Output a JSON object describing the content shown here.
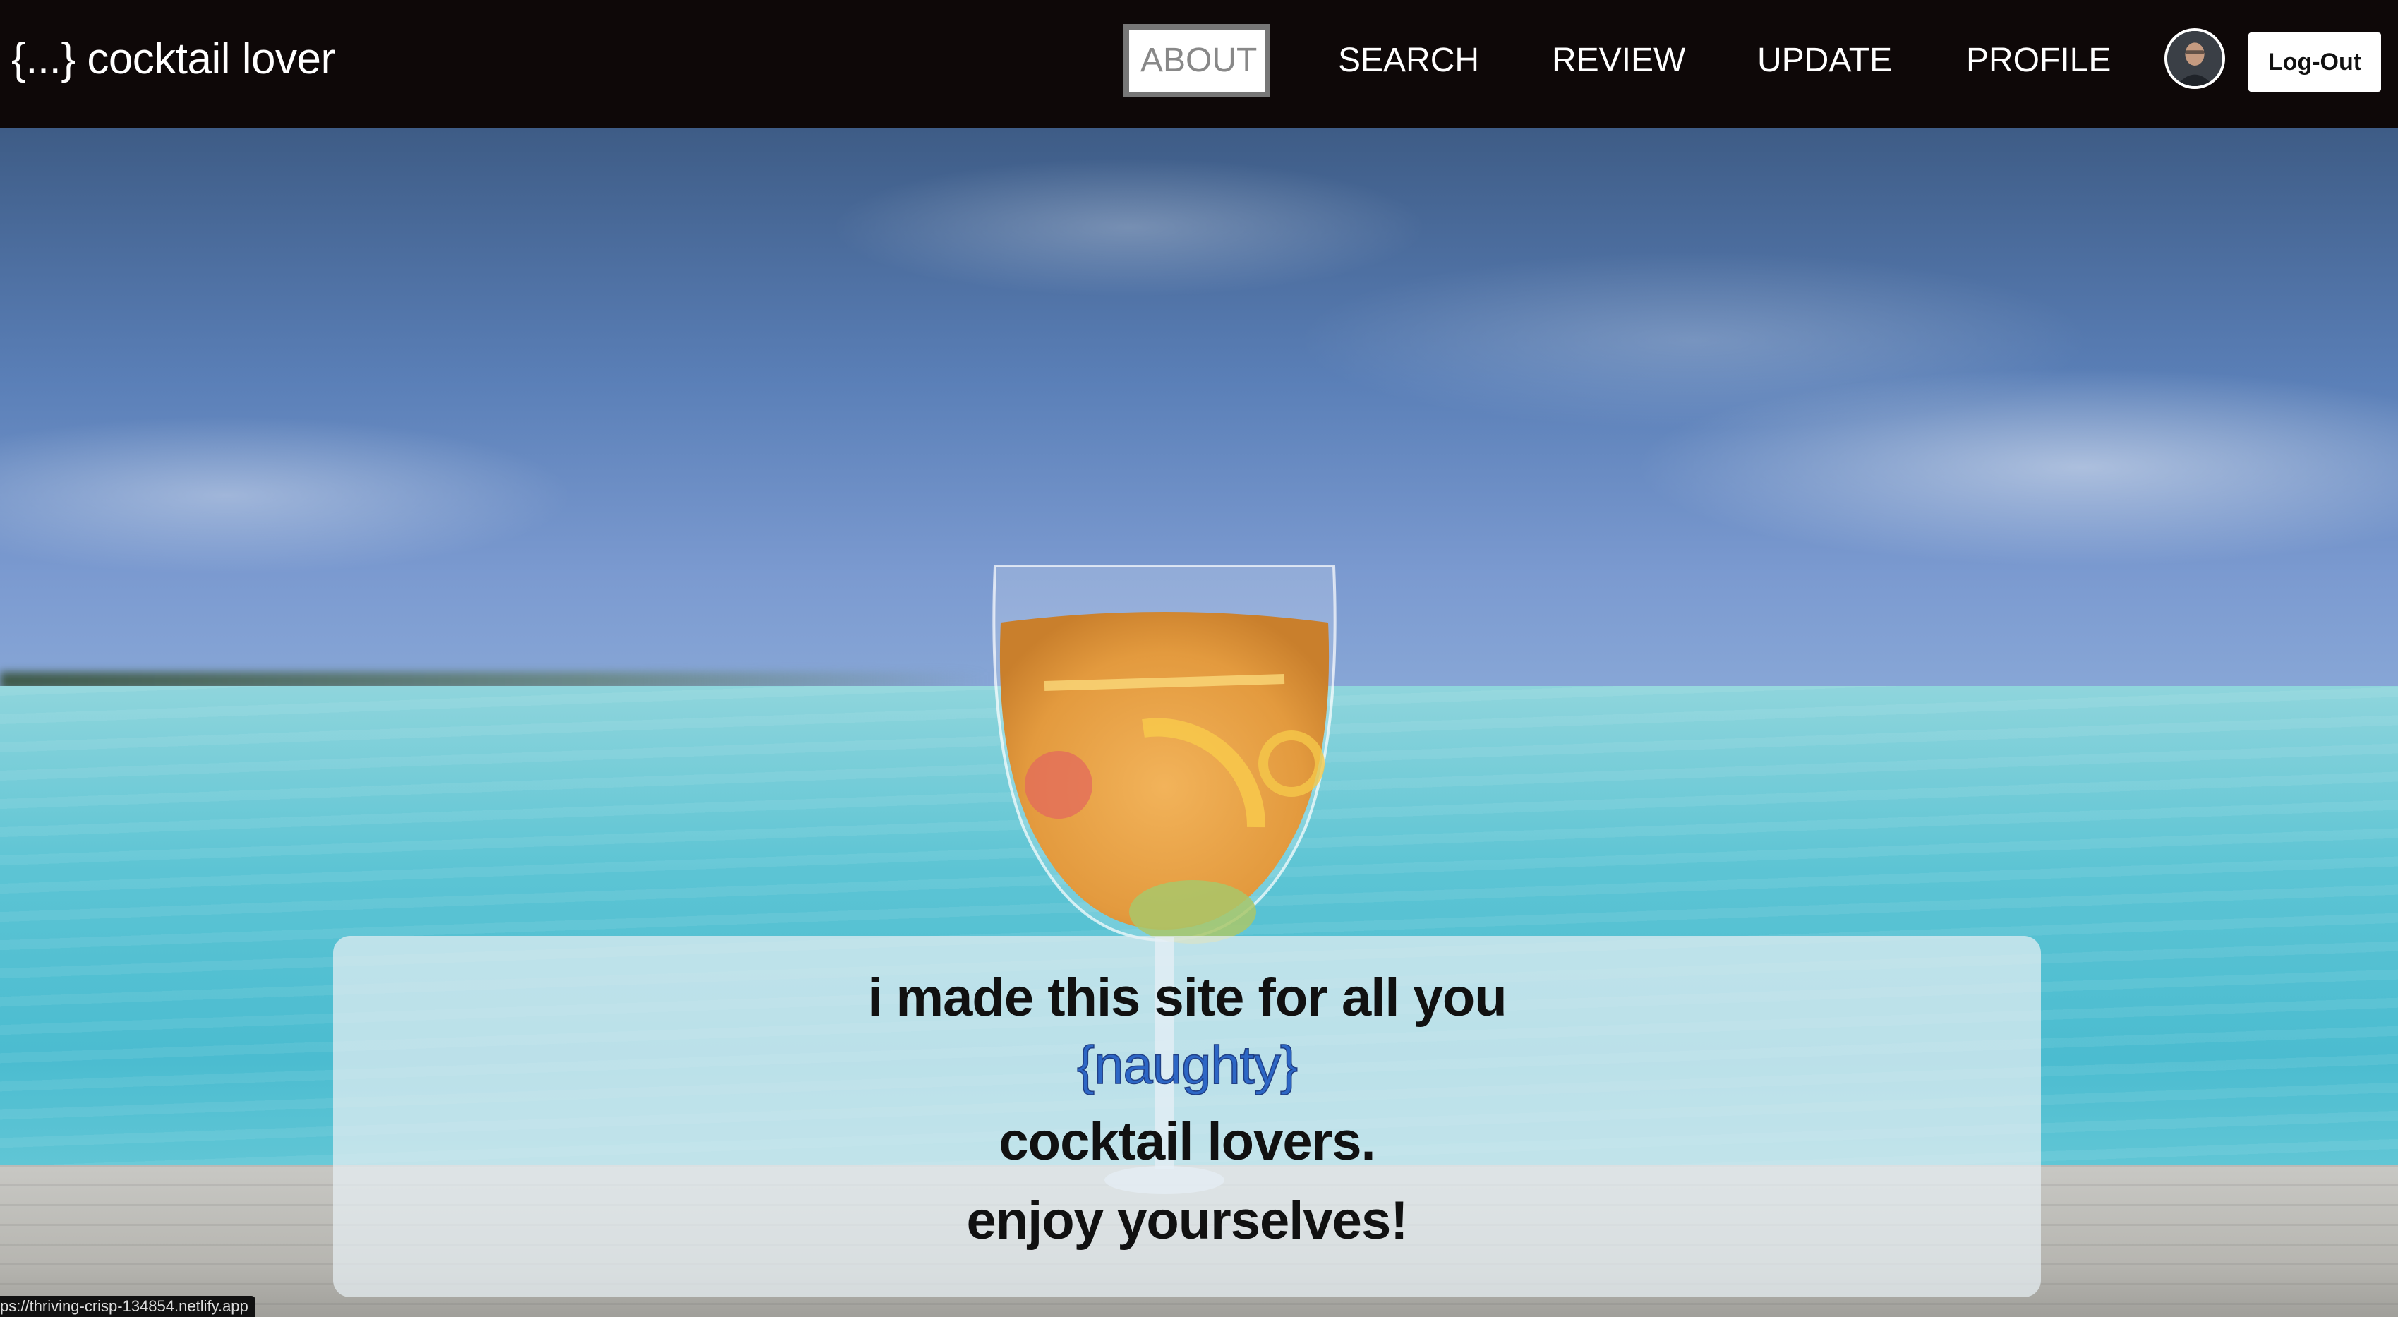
{
  "navbar": {
    "brand": "{...} cocktail lover",
    "items": [
      {
        "label": "ABOUT",
        "active": true
      },
      {
        "label": "SEARCH"
      },
      {
        "label": "REVIEW"
      },
      {
        "label": "UPDATE"
      },
      {
        "label": "PROFILE"
      }
    ],
    "avatar_icon": "user-avatar",
    "logout_label": "Log-Out"
  },
  "hero": {
    "lines": [
      "i made this site for all you",
      "{naughty}",
      "cocktail lovers.",
      "enjoy yourselves!"
    ],
    "highlight_color": "#2d66c5"
  },
  "status_bar": {
    "url": "ps://thriving-crisp-134854.netlify.app"
  }
}
